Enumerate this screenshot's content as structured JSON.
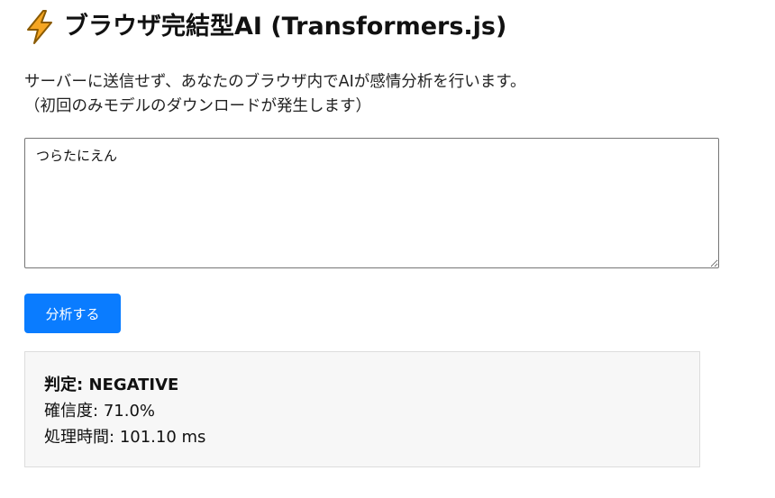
{
  "header": {
    "icon": "high-voltage-icon",
    "icon_color": "#f5a623",
    "title": "ブラウザ完結型AI (Transformers.js)"
  },
  "description": {
    "line1": "サーバーに送信せず、あなたのブラウザ内でAIが感情分析を行います。",
    "line2": "（初回のみモデルのダウンロードが発生します）"
  },
  "input": {
    "value": "つらたにえん"
  },
  "analyze_button": {
    "label": "分析する",
    "color": "#0a7cff"
  },
  "result": {
    "verdict_label": "判定:",
    "verdict_value": "NEGATIVE",
    "confidence_label": "確信度:",
    "confidence_value": "71.0%",
    "time_label": "処理時間:",
    "time_value": "101.10 ms"
  }
}
